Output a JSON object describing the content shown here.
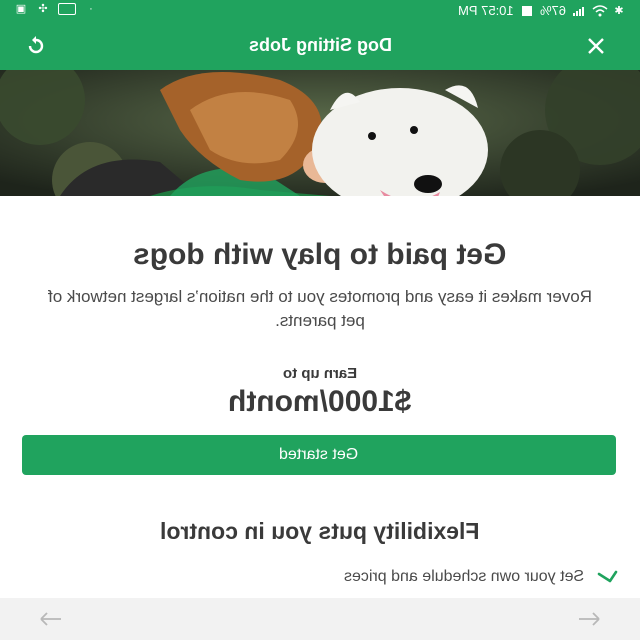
{
  "status_bar": {
    "time": "10:57 PM",
    "battery": "67%"
  },
  "toolbar": {
    "title": "Dog Sitting Jobs",
    "refresh_icon": "refresh-icon",
    "close_icon": "close-icon"
  },
  "hero": {
    "image": "woman hugging white dog"
  },
  "main": {
    "headline": "Get paid to play with dogs",
    "description": "Rover makes it easy and promotes you to the nation’s largest network of pet parents.",
    "earn_label": "Earn up to",
    "earn_amount": "$1000/month",
    "cta_label": "Get started",
    "section_title": "Flexibility puts you in control",
    "features": [
      {
        "label": "Set your own schedule and prices",
        "icon": "check-icon"
      }
    ]
  },
  "bottom_nav": {
    "back_icon": "arrow-left-icon",
    "forward_icon": "arrow-right-icon"
  },
  "colors": {
    "brand_green": "#20a35e",
    "text_dark": "#3a3a3a"
  }
}
